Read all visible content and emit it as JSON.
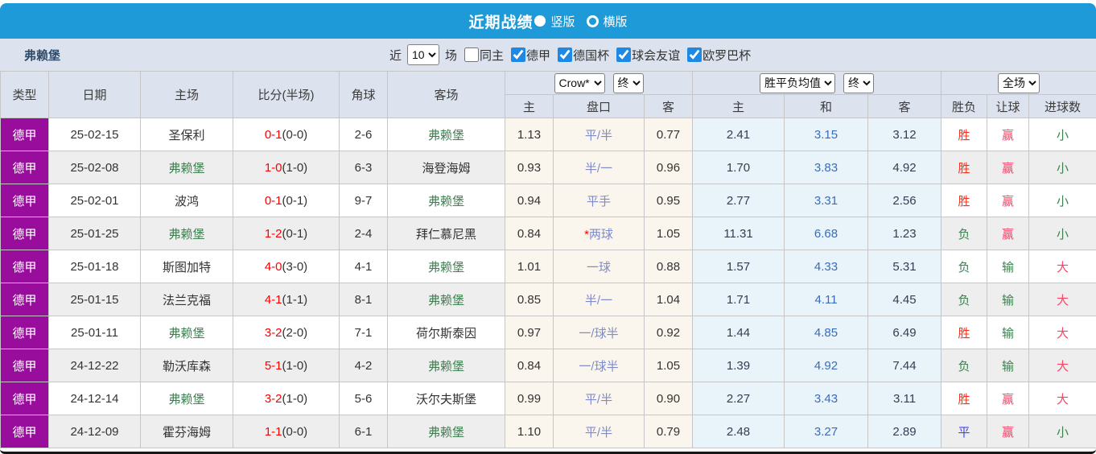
{
  "titlebar": {
    "title": "近期战绩",
    "vertical_label": "竖版",
    "horizontal_label": "横版"
  },
  "filterbar": {
    "team": "弗赖堡",
    "recent_label": "近",
    "recent_count": "10",
    "matches_label": "场",
    "same_home_label": "同主",
    "leagues": [
      "德甲",
      "德国杯",
      "球会友谊",
      "欧罗巴杯"
    ]
  },
  "table": {
    "header": {
      "type": "类型",
      "date": "日期",
      "home": "主场",
      "score": "比分(半场)",
      "corners": "角球",
      "away": "客场",
      "bookmaker_select": "Crow*",
      "odds_final_select": "终",
      "odds_home": "主",
      "odds_handicap": "盘口",
      "odds_away": "客",
      "mean_select": "胜平负均值",
      "mean_final_select": "终",
      "mean_home": "主",
      "mean_draw": "和",
      "mean_away": "客",
      "scope_select": "全场",
      "result": "胜负",
      "handicap_result": "让球",
      "goals": "进球数"
    },
    "rows": [
      {
        "league": "德甲",
        "date": "25-02-15",
        "home": "圣保利",
        "home_is_team": false,
        "score": "0-1",
        "half": "(0-0)",
        "corners": "2-6",
        "away": "弗赖堡",
        "away_is_team": true,
        "odds_home": "1.13",
        "handicap": "平/半",
        "handicap_star": false,
        "odds_away": "0.77",
        "mean_home": "2.41",
        "mean_draw": "3.15",
        "mean_away": "3.12",
        "result": "胜",
        "result_color": "red",
        "let_result": "赢",
        "let_color": "rose",
        "goals": "小",
        "goals_color": "green"
      },
      {
        "league": "德甲",
        "date": "25-02-08",
        "home": "弗赖堡",
        "home_is_team": true,
        "score": "1-0",
        "half": "(1-0)",
        "corners": "6-3",
        "away": "海登海姆",
        "away_is_team": false,
        "odds_home": "0.93",
        "handicap": "半/一",
        "handicap_star": false,
        "odds_away": "0.96",
        "mean_home": "1.70",
        "mean_draw": "3.83",
        "mean_away": "4.92",
        "result": "胜",
        "result_color": "red",
        "let_result": "赢",
        "let_color": "rose",
        "goals": "小",
        "goals_color": "green"
      },
      {
        "league": "德甲",
        "date": "25-02-01",
        "home": "波鸿",
        "home_is_team": false,
        "score": "0-1",
        "half": "(0-1)",
        "corners": "9-7",
        "away": "弗赖堡",
        "away_is_team": true,
        "odds_home": "0.94",
        "handicap": "平手",
        "handicap_star": false,
        "odds_away": "0.95",
        "mean_home": "2.77",
        "mean_draw": "3.31",
        "mean_away": "2.56",
        "result": "胜",
        "result_color": "red",
        "let_result": "赢",
        "let_color": "rose",
        "goals": "小",
        "goals_color": "green"
      },
      {
        "league": "德甲",
        "date": "25-01-25",
        "home": "弗赖堡",
        "home_is_team": true,
        "score": "1-2",
        "half": "(0-1)",
        "corners": "2-4",
        "away": "拜仁慕尼黑",
        "away_is_team": false,
        "odds_home": "0.84",
        "handicap": "两球",
        "handicap_star": true,
        "odds_away": "1.05",
        "mean_home": "11.31",
        "mean_draw": "6.68",
        "mean_away": "1.23",
        "result": "负",
        "result_color": "green",
        "let_result": "赢",
        "let_color": "rose",
        "goals": "小",
        "goals_color": "green"
      },
      {
        "league": "德甲",
        "date": "25-01-18",
        "home": "斯图加特",
        "home_is_team": false,
        "score": "4-0",
        "half": "(3-0)",
        "corners": "4-1",
        "away": "弗赖堡",
        "away_is_team": true,
        "odds_home": "1.01",
        "handicap": "一球",
        "handicap_star": false,
        "odds_away": "0.88",
        "mean_home": "1.57",
        "mean_draw": "4.33",
        "mean_away": "5.31",
        "result": "负",
        "result_color": "green",
        "let_result": "输",
        "let_color": "green",
        "goals": "大",
        "goals_color": "rose"
      },
      {
        "league": "德甲",
        "date": "25-01-15",
        "home": "法兰克福",
        "home_is_team": false,
        "score": "4-1",
        "half": "(1-1)",
        "corners": "8-1",
        "away": "弗赖堡",
        "away_is_team": true,
        "odds_home": "0.85",
        "handicap": "半/一",
        "handicap_star": false,
        "odds_away": "1.04",
        "mean_home": "1.71",
        "mean_draw": "4.11",
        "mean_away": "4.45",
        "result": "负",
        "result_color": "green",
        "let_result": "输",
        "let_color": "green",
        "goals": "大",
        "goals_color": "rose"
      },
      {
        "league": "德甲",
        "date": "25-01-11",
        "home": "弗赖堡",
        "home_is_team": true,
        "score": "3-2",
        "half": "(2-0)",
        "corners": "7-1",
        "away": "荷尔斯泰因",
        "away_is_team": false,
        "odds_home": "0.97",
        "handicap": "一/球半",
        "handicap_star": false,
        "odds_away": "0.92",
        "mean_home": "1.44",
        "mean_draw": "4.85",
        "mean_away": "6.49",
        "result": "胜",
        "result_color": "red",
        "let_result": "输",
        "let_color": "green",
        "goals": "大",
        "goals_color": "rose"
      },
      {
        "league": "德甲",
        "date": "24-12-22",
        "home": "勒沃库森",
        "home_is_team": false,
        "score": "5-1",
        "half": "(1-0)",
        "corners": "4-2",
        "away": "弗赖堡",
        "away_is_team": true,
        "odds_home": "0.84",
        "handicap": "一/球半",
        "handicap_star": false,
        "odds_away": "1.05",
        "mean_home": "1.39",
        "mean_draw": "4.92",
        "mean_away": "7.44",
        "result": "负",
        "result_color": "green",
        "let_result": "输",
        "let_color": "green",
        "goals": "大",
        "goals_color": "rose"
      },
      {
        "league": "德甲",
        "date": "24-12-14",
        "home": "弗赖堡",
        "home_is_team": true,
        "score": "3-2",
        "half": "(1-0)",
        "corners": "5-6",
        "away": "沃尔夫斯堡",
        "away_is_team": false,
        "odds_home": "0.99",
        "handicap": "平/半",
        "handicap_star": false,
        "odds_away": "0.90",
        "mean_home": "2.27",
        "mean_draw": "3.43",
        "mean_away": "3.11",
        "result": "胜",
        "result_color": "red",
        "let_result": "赢",
        "let_color": "rose",
        "goals": "大",
        "goals_color": "rose"
      },
      {
        "league": "德甲",
        "date": "24-12-09",
        "home": "霍芬海姆",
        "home_is_team": false,
        "score": "1-1",
        "half": "(0-0)",
        "corners": "6-1",
        "away": "弗赖堡",
        "away_is_team": true,
        "odds_home": "1.10",
        "handicap": "平/半",
        "handicap_star": false,
        "odds_away": "0.79",
        "mean_home": "2.48",
        "mean_draw": "3.27",
        "mean_away": "2.89",
        "result": "平",
        "result_color": "blue",
        "let_result": "赢",
        "let_color": "rose",
        "goals": "小",
        "goals_color": "green"
      }
    ]
  },
  "colors": {
    "c_topbar": "#1d9ad7",
    "c_panel": "#dde3ee",
    "c_purple": "#990d9d",
    "c_even": "#eeeeee",
    "c_cream": "#fbf6ed",
    "c_lblue": "#e9f3fa",
    "c_teamgreen": "#3d8050",
    "c_scorered": "#ff0000",
    "c_peri": "#7e8bc7",
    "c_meanblue": "#3a6db8",
    "c_red": "#f4321c",
    "c_rose": "#fb4368",
    "c_green": "#3d8050",
    "c_blue": "#4343f4"
  }
}
